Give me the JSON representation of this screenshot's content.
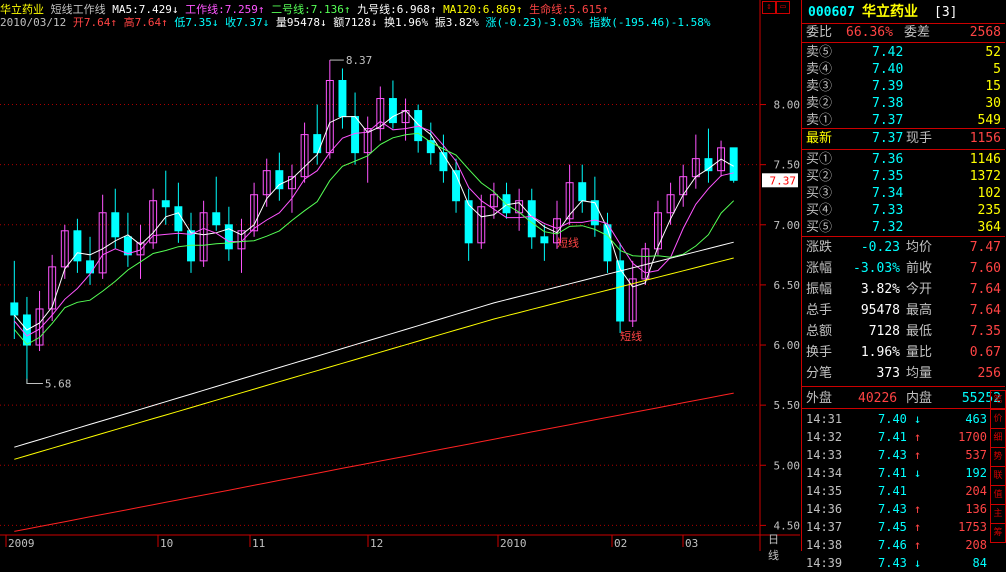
{
  "header": {
    "stock_name": "华立药业",
    "indicator_name": "短线工作线",
    "ma5": "MA5:7.429↓",
    "work_line": "工作线:7.259↑",
    "line2": "二号线:7.136↑",
    "line9": "九号线:6.968↑",
    "ma120": "MA120:6.869↑",
    "life_line": "生命线:5.615↑",
    "date": "2010/03/12",
    "open": "开7.64↑",
    "high": "高7.64↑",
    "low": "低7.35↓",
    "close": "收7.37↓",
    "volume": "量95478↓",
    "amount": "额7128↓",
    "turnover": "换1.96%",
    "amplitude": "振3.82%",
    "change": "涨(-0.23)-3.03%",
    "index_change": "指数(-195.46)-1.58%"
  },
  "chart_data": {
    "type": "candlestick",
    "ylim": [
      4.42,
      8.62
    ],
    "y_ticks": [
      "8.00",
      "7.50",
      "7.00",
      "6.50",
      "6.00",
      "5.50",
      "5.00",
      "4.50"
    ],
    "x_labels": [
      "2009",
      "10",
      "11",
      "12",
      "2010",
      "02",
      "03"
    ],
    "period_label": "日线",
    "max_annotation": "8.37",
    "min_annotation": "5.68",
    "current_price_tag": "7.37",
    "short_line_labels": [
      "短线",
      "短线"
    ],
    "candles": [
      [
        6.35,
        6.7,
        6.05,
        6.25
      ],
      [
        6.25,
        6.4,
        5.68,
        6.0
      ],
      [
        6.0,
        6.45,
        5.95,
        6.3
      ],
      [
        6.3,
        6.75,
        6.2,
        6.65
      ],
      [
        6.65,
        7.0,
        6.55,
        6.95
      ],
      [
        6.95,
        7.05,
        6.6,
        6.7
      ],
      [
        6.7,
        6.9,
        6.5,
        6.6
      ],
      [
        6.6,
        7.25,
        6.55,
        7.1
      ],
      [
        7.1,
        7.3,
        6.8,
        6.9
      ],
      [
        6.9,
        7.1,
        6.65,
        6.75
      ],
      [
        6.75,
        7.0,
        6.55,
        6.85
      ],
      [
        6.85,
        7.3,
        6.8,
        7.2
      ],
      [
        7.2,
        7.45,
        7.0,
        7.15
      ],
      [
        7.15,
        7.35,
        6.85,
        6.95
      ],
      [
        6.95,
        7.1,
        6.6,
        6.7
      ],
      [
        6.7,
        7.2,
        6.65,
        7.1
      ],
      [
        7.1,
        7.4,
        6.95,
        7.0
      ],
      [
        7.0,
        7.15,
        6.7,
        6.8
      ],
      [
        6.8,
        7.05,
        6.6,
        6.95
      ],
      [
        6.95,
        7.35,
        6.9,
        7.25
      ],
      [
        7.25,
        7.55,
        7.15,
        7.45
      ],
      [
        7.45,
        7.6,
        7.2,
        7.3
      ],
      [
        7.3,
        7.5,
        7.1,
        7.4
      ],
      [
        7.4,
        7.85,
        7.35,
        7.75
      ],
      [
        7.75,
        8.0,
        7.5,
        7.6
      ],
      [
        7.6,
        8.37,
        7.55,
        8.2
      ],
      [
        8.2,
        8.3,
        7.8,
        7.9
      ],
      [
        7.9,
        8.1,
        7.5,
        7.6
      ],
      [
        7.6,
        7.9,
        7.35,
        7.8
      ],
      [
        7.8,
        8.15,
        7.7,
        8.05
      ],
      [
        8.05,
        8.2,
        7.8,
        7.85
      ],
      [
        7.85,
        8.05,
        7.7,
        7.95
      ],
      [
        7.95,
        8.0,
        7.6,
        7.7
      ],
      [
        7.7,
        7.85,
        7.5,
        7.6
      ],
      [
        7.6,
        7.75,
        7.35,
        7.45
      ],
      [
        7.45,
        7.55,
        7.1,
        7.2
      ],
      [
        7.2,
        7.3,
        6.7,
        6.85
      ],
      [
        6.85,
        7.25,
        6.8,
        7.15
      ],
      [
        7.15,
        7.35,
        7.05,
        7.25
      ],
      [
        7.25,
        7.35,
        7.05,
        7.1
      ],
      [
        7.1,
        7.3,
        6.95,
        7.2
      ],
      [
        7.2,
        7.3,
        6.8,
        6.9
      ],
      [
        6.9,
        7.0,
        6.7,
        6.85
      ],
      [
        6.85,
        7.2,
        6.8,
        7.05
      ],
      [
        7.05,
        7.5,
        7.0,
        7.35
      ],
      [
        7.35,
        7.5,
        7.1,
        7.2
      ],
      [
        7.2,
        7.4,
        6.9,
        7.0
      ],
      [
        7.0,
        7.1,
        6.6,
        6.7
      ],
      [
        6.7,
        6.85,
        6.1,
        6.2
      ],
      [
        6.2,
        6.7,
        6.15,
        6.55
      ],
      [
        6.55,
        6.85,
        6.5,
        6.8
      ],
      [
        6.8,
        7.2,
        6.75,
        7.1
      ],
      [
        7.1,
        7.35,
        7.0,
        7.25
      ],
      [
        7.25,
        7.5,
        7.15,
        7.4
      ],
      [
        7.4,
        7.75,
        7.3,
        7.55
      ],
      [
        7.55,
        7.8,
        7.35,
        7.45
      ],
      [
        7.45,
        7.7,
        7.4,
        7.64
      ],
      [
        7.64,
        7.64,
        7.35,
        7.37
      ]
    ]
  },
  "quote": {
    "code": "000607",
    "name": "华立药业",
    "bracket": "[3]",
    "weibi_label": "委比",
    "weibi_val": "66.36%",
    "weicha_label": "委差",
    "weicha_val": "2568",
    "asks": [
      {
        "label": "卖⑤",
        "price": "7.42",
        "vol": "52"
      },
      {
        "label": "卖④",
        "price": "7.40",
        "vol": "5"
      },
      {
        "label": "卖③",
        "price": "7.39",
        "vol": "15"
      },
      {
        "label": "卖②",
        "price": "7.38",
        "vol": "30"
      },
      {
        "label": "卖①",
        "price": "7.37",
        "vol": "549"
      }
    ],
    "latest_label": "最新",
    "latest_val": "7.37",
    "xianshou_label": "现手",
    "xianshou_val": "1156",
    "bids": [
      {
        "label": "买①",
        "price": "7.36",
        "vol": "1146"
      },
      {
        "label": "买②",
        "price": "7.35",
        "vol": "1372"
      },
      {
        "label": "买③",
        "price": "7.34",
        "vol": "102"
      },
      {
        "label": "买④",
        "price": "7.33",
        "vol": "235"
      },
      {
        "label": "买⑤",
        "price": "7.32",
        "vol": "364"
      }
    ],
    "stats": [
      {
        "l1": "涨跌",
        "v1": "-0.23",
        "l2": "均价",
        "v2": "7.47"
      },
      {
        "l1": "涨幅",
        "v1": "-3.03%",
        "l2": "前收",
        "v2": "7.60"
      },
      {
        "l1": "振幅",
        "v1": "3.82%",
        "l2": "今开",
        "v2": "7.64"
      },
      {
        "l1": "总手",
        "v1": "95478",
        "l2": "最高",
        "v2": "7.64"
      },
      {
        "l1": "总额",
        "v1": "7128",
        "l2": "最低",
        "v2": "7.35"
      },
      {
        "l1": "换手",
        "v1": "1.96%",
        "l2": "量比",
        "v2": "0.67"
      },
      {
        "l1": "分笔",
        "v1": "373",
        "l2": "均量",
        "v2": "256"
      }
    ],
    "outer_label": "外盘",
    "outer_val": "40226",
    "inner_label": "内盘",
    "inner_val": "55252",
    "ticks": [
      {
        "time": "14:31",
        "price": "7.40",
        "dir": "down",
        "vol": "463"
      },
      {
        "time": "14:32",
        "price": "7.41",
        "dir": "up",
        "vol": "1700"
      },
      {
        "time": "14:33",
        "price": "7.43",
        "dir": "up",
        "vol": "537"
      },
      {
        "time": "14:34",
        "price": "7.41",
        "dir": "down",
        "vol": "192"
      },
      {
        "time": "14:35",
        "price": "7.41",
        "dir": "none",
        "vol": "204"
      },
      {
        "time": "14:36",
        "price": "7.43",
        "dir": "up",
        "vol": "136"
      },
      {
        "time": "14:37",
        "price": "7.45",
        "dir": "up",
        "vol": "1753"
      },
      {
        "time": "14:38",
        "price": "7.46",
        "dir": "up",
        "vol": "208"
      },
      {
        "time": "14:39",
        "price": "7.43",
        "dir": "down",
        "vol": "84"
      }
    ],
    "side_buttons": [
      "笔",
      "价",
      "细",
      "势",
      "联",
      "值",
      "主",
      "筹"
    ]
  },
  "colors": {
    "up": "#ff5555",
    "down": "#00ffff",
    "yellow": "#ffff00",
    "white": "#ffffff",
    "magenta": "#ff55ff",
    "green": "#55ff55",
    "grid": "#aa0000",
    "border": "#cc0000"
  }
}
